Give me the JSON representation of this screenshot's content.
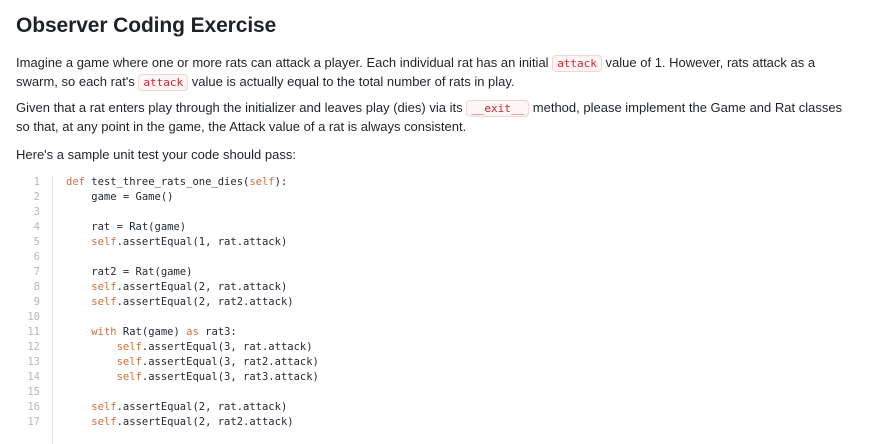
{
  "title": "Observer Coding Exercise",
  "paragraph1": {
    "part1": "Imagine a game where one or more rats can attack a player. Each individual rat has an initial ",
    "code1": "attack",
    "part2": " value of 1. However, rats attack as a swarm, so each rat's ",
    "code2": "attack",
    "part3": " value is actually equal to the total number of rats in play."
  },
  "paragraph2": {
    "part1": "Given that a rat enters play through the initializer and leaves play (dies) via its ",
    "code1": "__exit__",
    "part2": " method, please implement the Game and Rat classes so that, at any point in the game, the Attack value of a rat is always consistent."
  },
  "paragraph3": "Here's a sample unit test your code should pass:",
  "code_lines": [
    {
      "n": "1",
      "tokens": [
        {
          "t": "def ",
          "c": "kw"
        },
        {
          "t": "test_three_rats_one_dies(",
          "c": ""
        },
        {
          "t": "self",
          "c": "self"
        },
        {
          "t": "):",
          "c": ""
        }
      ]
    },
    {
      "n": "2",
      "tokens": [
        {
          "t": "    game = Game()",
          "c": ""
        }
      ]
    },
    {
      "n": "3",
      "tokens": []
    },
    {
      "n": "4",
      "tokens": [
        {
          "t": "    rat = Rat(game)",
          "c": ""
        }
      ]
    },
    {
      "n": "5",
      "tokens": [
        {
          "t": "    ",
          "c": ""
        },
        {
          "t": "self",
          "c": "self"
        },
        {
          "t": ".assertEqual(1, rat.attack)",
          "c": ""
        }
      ]
    },
    {
      "n": "6",
      "tokens": []
    },
    {
      "n": "7",
      "tokens": [
        {
          "t": "    rat2 = Rat(game)",
          "c": ""
        }
      ]
    },
    {
      "n": "8",
      "tokens": [
        {
          "t": "    ",
          "c": ""
        },
        {
          "t": "self",
          "c": "self"
        },
        {
          "t": ".assertEqual(2, rat.attack)",
          "c": ""
        }
      ]
    },
    {
      "n": "9",
      "tokens": [
        {
          "t": "    ",
          "c": ""
        },
        {
          "t": "self",
          "c": "self"
        },
        {
          "t": ".assertEqual(2, rat2.attack)",
          "c": ""
        }
      ]
    },
    {
      "n": "10",
      "tokens": []
    },
    {
      "n": "11",
      "tokens": [
        {
          "t": "    ",
          "c": ""
        },
        {
          "t": "with",
          "c": "kw"
        },
        {
          "t": " Rat(game) ",
          "c": ""
        },
        {
          "t": "as",
          "c": "kw"
        },
        {
          "t": " rat3:",
          "c": ""
        }
      ]
    },
    {
      "n": "12",
      "tokens": [
        {
          "t": "        ",
          "c": ""
        },
        {
          "t": "self",
          "c": "self"
        },
        {
          "t": ".assertEqual(3, rat.attack)",
          "c": ""
        }
      ]
    },
    {
      "n": "13",
      "tokens": [
        {
          "t": "        ",
          "c": ""
        },
        {
          "t": "self",
          "c": "self"
        },
        {
          "t": ".assertEqual(3, rat2.attack)",
          "c": ""
        }
      ]
    },
    {
      "n": "14",
      "tokens": [
        {
          "t": "        ",
          "c": ""
        },
        {
          "t": "self",
          "c": "self"
        },
        {
          "t": ".assertEqual(3, rat3.attack)",
          "c": ""
        }
      ]
    },
    {
      "n": "15",
      "tokens": []
    },
    {
      "n": "16",
      "tokens": [
        {
          "t": "    ",
          "c": ""
        },
        {
          "t": "self",
          "c": "self"
        },
        {
          "t": ".assertEqual(2, rat.attack)",
          "c": ""
        }
      ]
    },
    {
      "n": "17",
      "tokens": [
        {
          "t": "    ",
          "c": ""
        },
        {
          "t": "self",
          "c": "self"
        },
        {
          "t": ".assertEqual(2, rat2.attack)",
          "c": ""
        }
      ]
    }
  ],
  "colors": {
    "keyword": "#cf6f3a",
    "inline_code": "#d1242f",
    "line_number": "#b4b8bd"
  }
}
